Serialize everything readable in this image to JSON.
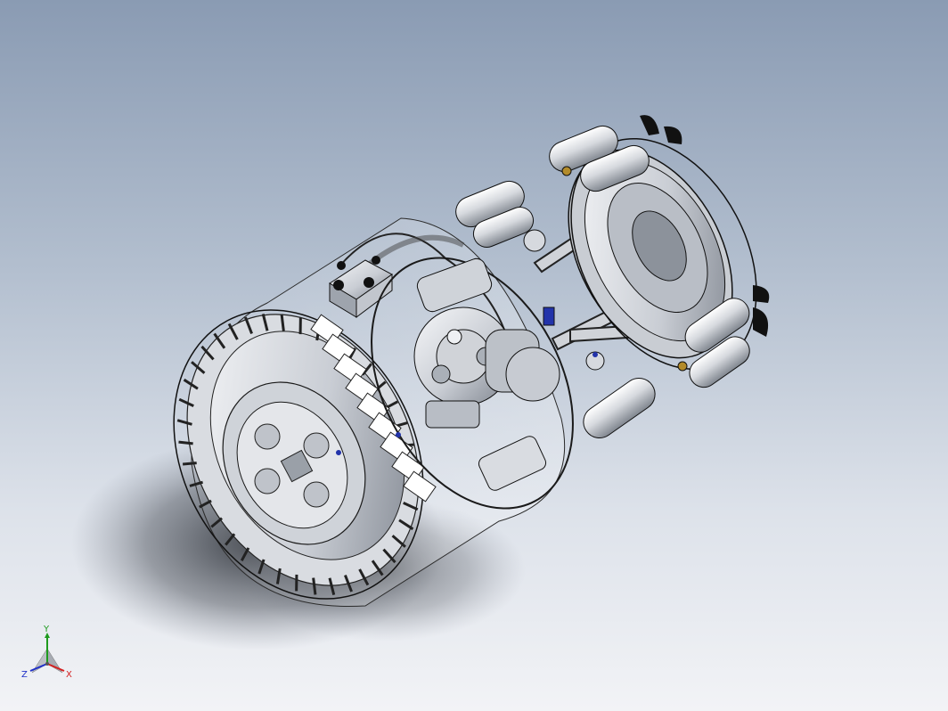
{
  "app": {
    "view": "isometric-shaded-with-edges",
    "background": "gradient-sky"
  },
  "model": {
    "name": "",
    "type": "exploded-assembly"
  },
  "triad": {
    "x_label": "X",
    "y_label": "Y",
    "z_label": "Z",
    "colors": {
      "x": "#d42020",
      "y": "#1e9a1e",
      "z": "#2030c8"
    }
  },
  "colors": {
    "metal_light": "#eef0f3",
    "metal_mid": "#c4c8cf",
    "metal_dark": "#6d727b",
    "edge": "#1a1a1a",
    "shadow": "#2a2e36",
    "accent_blue": "#2233aa",
    "brass": "#b38b2a"
  }
}
